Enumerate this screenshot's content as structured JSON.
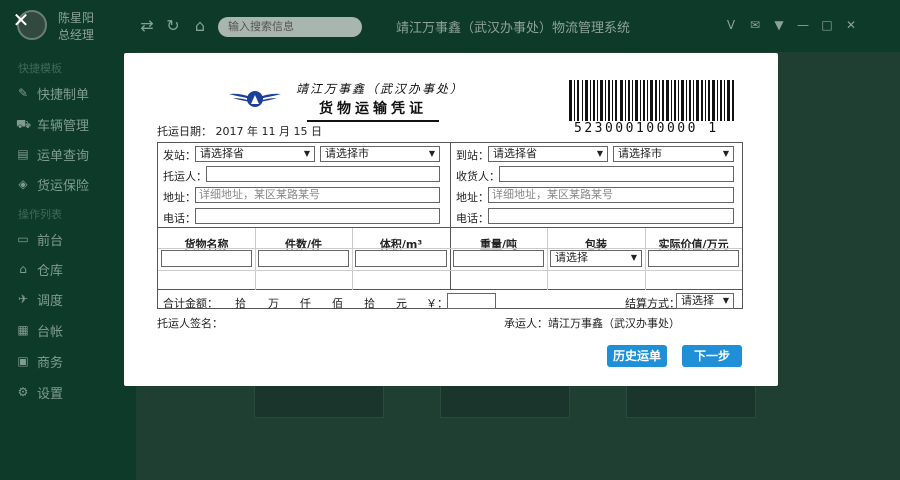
{
  "user": {
    "name": "陈星阳",
    "role": "总经理"
  },
  "sidebar": {
    "section1": "快捷模板",
    "section2": "操作列表",
    "items": [
      {
        "label": "快捷制单",
        "icon": "pencil-icon"
      },
      {
        "label": "车辆管理",
        "icon": "truck-icon"
      },
      {
        "label": "运单查询",
        "icon": "document-icon"
      },
      {
        "label": "货运保险",
        "icon": "shield-icon"
      },
      {
        "label": "前台",
        "icon": "monitor-icon"
      },
      {
        "label": "仓库",
        "icon": "warehouse-icon"
      },
      {
        "label": "调度",
        "icon": "dispatch-icon"
      },
      {
        "label": "台帐",
        "icon": "ledger-icon"
      },
      {
        "label": "商务",
        "icon": "briefcase-icon"
      },
      {
        "label": "设置",
        "icon": "gear-icon"
      }
    ]
  },
  "topbar": {
    "search_placeholder": "输入搜索信息",
    "title": "靖江万事鑫（武汉办事处）物流管理系统"
  },
  "waybill": {
    "company": "靖江万事鑫（武汉办事处）",
    "title": "货物运输凭证",
    "barcode_number": "523000100000 1",
    "date_label": "托运日期：",
    "date_value": "2017 年 11 月 15 日",
    "from_station_label": "发站：",
    "to_station_label": "到站：",
    "province_placeholder": "请选择省",
    "city_placeholder": "请选择市",
    "shipper_label": "托运人：",
    "consignee_label": "收货人：",
    "address_label": "地址：",
    "address_placeholder": "详细地址，某区某路某号",
    "phone_label": "电话：",
    "columns": [
      "货物名称",
      "件数/件",
      "体积/m³",
      "重量/吨",
      "包装",
      "实际价值/万元"
    ],
    "packaging_placeholder": "请选择",
    "total_label": "合计金额：",
    "units": [
      "拾",
      "万",
      "仟",
      "佰",
      "拾",
      "元",
      "￥："
    ],
    "settlement_label": "结算方式：",
    "settlement_placeholder": "请选择",
    "shipper_sign_label": "托运人签名：",
    "carrier_label": "承运人：靖江万事鑫（武汉办事处）"
  },
  "buttons": {
    "history": "历史运单",
    "next": "下一步"
  },
  "colors": {
    "accent": "#1f8fd8",
    "sidebar_bg": "#0e3a2a",
    "logo_blue": "#1c3f9a"
  }
}
